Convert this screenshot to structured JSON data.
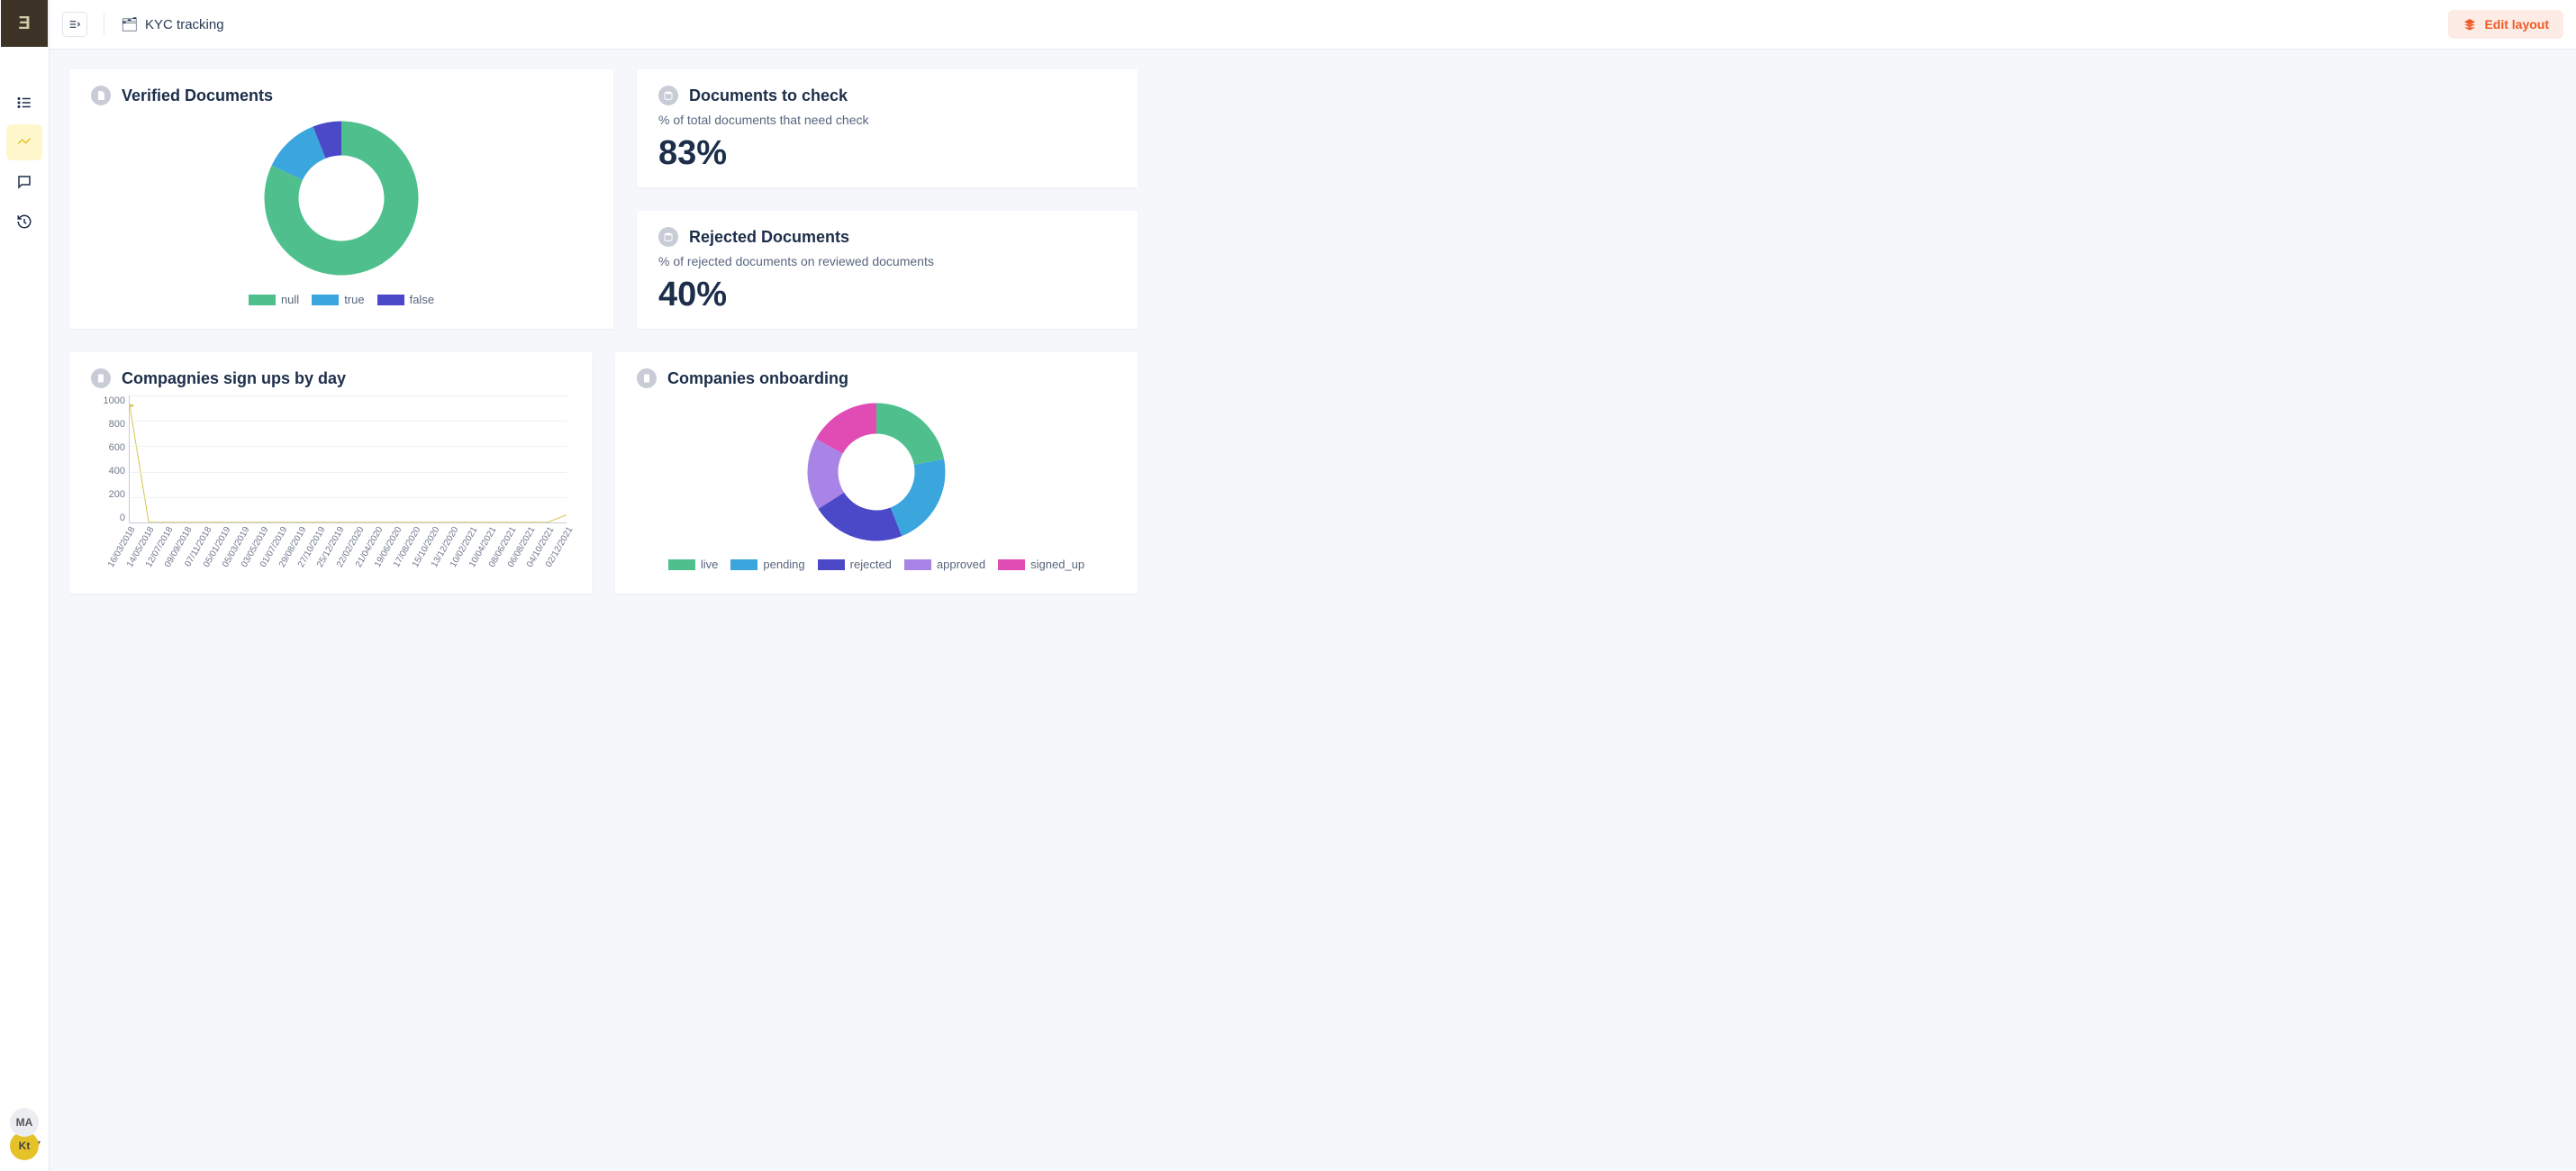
{
  "leftnav": {
    "avatars": {
      "top": "MA",
      "bottom": "Kt"
    }
  },
  "topbar": {
    "page_emoji": "🗂",
    "page_title": "KYC tracking",
    "edit_label": "Edit layout"
  },
  "cards": {
    "verified": {
      "title": "Verified Documents"
    },
    "docs_to_check": {
      "title": "Documents to check",
      "sub": "% of total documents that need check",
      "value": "83%"
    },
    "rejected": {
      "title": "Rejected Documents",
      "sub": "% of rejected documents on reviewed documents",
      "value": "40%"
    },
    "signups": {
      "title": "Compagnies sign ups by day"
    },
    "onboarding": {
      "title": "Companies onboarding"
    }
  },
  "chart_data": [
    {
      "id": "verified_documents",
      "type": "pie",
      "title": "Verified Documents",
      "series": [
        {
          "name": "null",
          "value": 82,
          "color": "#4fc08d"
        },
        {
          "name": "true",
          "value": 12,
          "color": "#3aa6dd"
        },
        {
          "name": "false",
          "value": 6,
          "color": "#4b49c8"
        }
      ]
    },
    {
      "id": "signups_by_day",
      "type": "line",
      "title": "Compagnies sign ups by day",
      "ylabel": "",
      "xlabel": "",
      "ylim": [
        0,
        1000
      ],
      "yticks": [
        0,
        200,
        400,
        600,
        800,
        1000
      ],
      "categories": [
        "16/03/2018",
        "14/05/2018",
        "12/07/2018",
        "09/09/2018",
        "07/11/2018",
        "05/01/2019",
        "05/03/2019",
        "03/05/2019",
        "01/07/2019",
        "29/08/2019",
        "27/10/2019",
        "25/12/2019",
        "22/02/2020",
        "21/04/2020",
        "19/06/2020",
        "17/08/2020",
        "15/10/2020",
        "13/12/2020",
        "10/02/2021",
        "10/04/2021",
        "08/06/2021",
        "06/08/2021",
        "04/10/2021",
        "02/12/2021"
      ],
      "values": [
        920,
        1,
        1,
        1,
        1,
        1,
        1,
        1,
        1,
        1,
        1,
        1,
        1,
        1,
        1,
        1,
        1,
        1,
        1,
        1,
        1,
        1,
        1,
        60
      ],
      "color": "#d4c64a"
    },
    {
      "id": "companies_onboarding",
      "type": "pie",
      "title": "Companies onboarding",
      "series": [
        {
          "name": "live",
          "value": 22,
          "color": "#4fc08d"
        },
        {
          "name": "pending",
          "value": 22,
          "color": "#3aa6dd"
        },
        {
          "name": "rejected",
          "value": 22,
          "color": "#4b49c8"
        },
        {
          "name": "approved",
          "value": 17,
          "color": "#a884e6"
        },
        {
          "name": "signed_up",
          "value": 17,
          "color": "#e14bb4"
        }
      ]
    }
  ]
}
